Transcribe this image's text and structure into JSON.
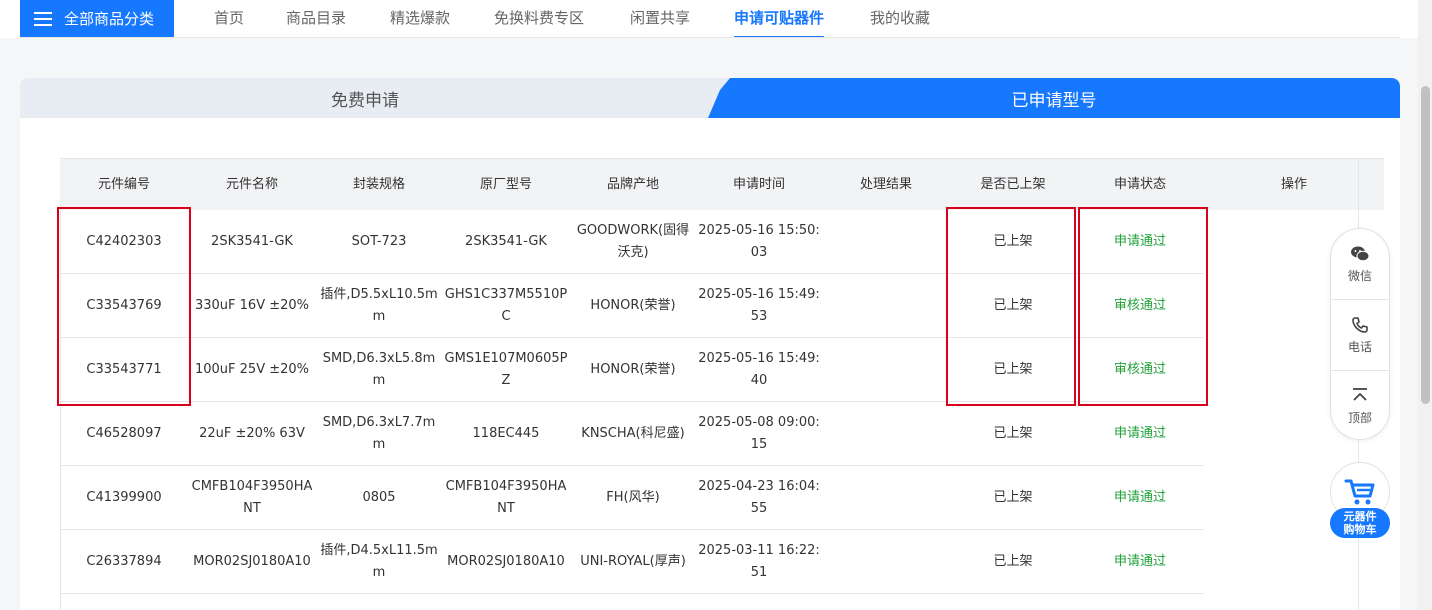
{
  "nav": {
    "category_button": "全部商品分类",
    "items": [
      {
        "label": "首页",
        "active": false
      },
      {
        "label": "商品目录",
        "active": false
      },
      {
        "label": "精选爆款",
        "active": false
      },
      {
        "label": "免换料费专区",
        "active": false
      },
      {
        "label": "闲置共享",
        "active": false
      },
      {
        "label": "申请可贴器件",
        "active": true
      },
      {
        "label": "我的收藏",
        "active": false
      }
    ]
  },
  "tabs": {
    "free": "免费申请",
    "applied": "已申请型号"
  },
  "table": {
    "headers": [
      "元件编号",
      "元件名称",
      "封装规格",
      "原厂型号",
      "品牌产地",
      "申请时间",
      "处理结果",
      "是否已上架",
      "申请状态",
      "操作"
    ],
    "rows": [
      {
        "code": "C42402303",
        "name": "2SK3541-GK",
        "package": "SOT-723",
        "mfr_part": "2SK3541-GK",
        "brand": "GOODWORK(固得沃克)",
        "time": "2025-05-16 15:50:03",
        "result": "",
        "listed": "已上架",
        "status": "申请通过"
      },
      {
        "code": "C33543769",
        "name": "330uF 16V ±20%",
        "package": "插件,D5.5xL10.5mm",
        "mfr_part": "GHS1C337M5510PC",
        "brand": "HONOR(荣誉)",
        "time": "2025-05-16 15:49:53",
        "result": "",
        "listed": "已上架",
        "status": "审核通过"
      },
      {
        "code": "C33543771",
        "name": "100uF 25V ±20%",
        "package": "SMD,D6.3xL5.8mm",
        "mfr_part": "GMS1E107M0605PZ",
        "brand": "HONOR(荣誉)",
        "time": "2025-05-16 15:49:40",
        "result": "",
        "listed": "已上架",
        "status": "审核通过"
      },
      {
        "code": "C46528097",
        "name": "22uF ±20% 63V",
        "package": "SMD,D6.3xL7.7mm",
        "mfr_part": "118EC445",
        "brand": "KNSCHA(科尼盛)",
        "time": "2025-05-08 09:00:15",
        "result": "",
        "listed": "已上架",
        "status": "申请通过"
      },
      {
        "code": "C41399900",
        "name": "CMFB104F3950HANT",
        "package": "0805",
        "mfr_part": "CMFB104F3950HANT",
        "brand": "FH(风华)",
        "time": "2025-04-23 16:04:55",
        "result": "",
        "listed": "已上架",
        "status": "申请通过"
      },
      {
        "code": "C26337894",
        "name": "MOR02SJ0180A10",
        "package": "插件,D4.5xL11.5mm",
        "mfr_part": "MOR02SJ0180A10",
        "brand": "UNI-ROYAL(厚声)",
        "time": "2025-03-11 16:22:51",
        "result": "",
        "listed": "已上架",
        "status": "申请通过"
      }
    ]
  },
  "float_bar": {
    "wechat": "微信",
    "phone": "电话",
    "top": "顶部",
    "cart_line1": "元器件",
    "cart_line2": "购物车"
  },
  "colors": {
    "accent": "#1677ff",
    "status_green": "#22a03a",
    "highlight_red": "#d9001b"
  }
}
